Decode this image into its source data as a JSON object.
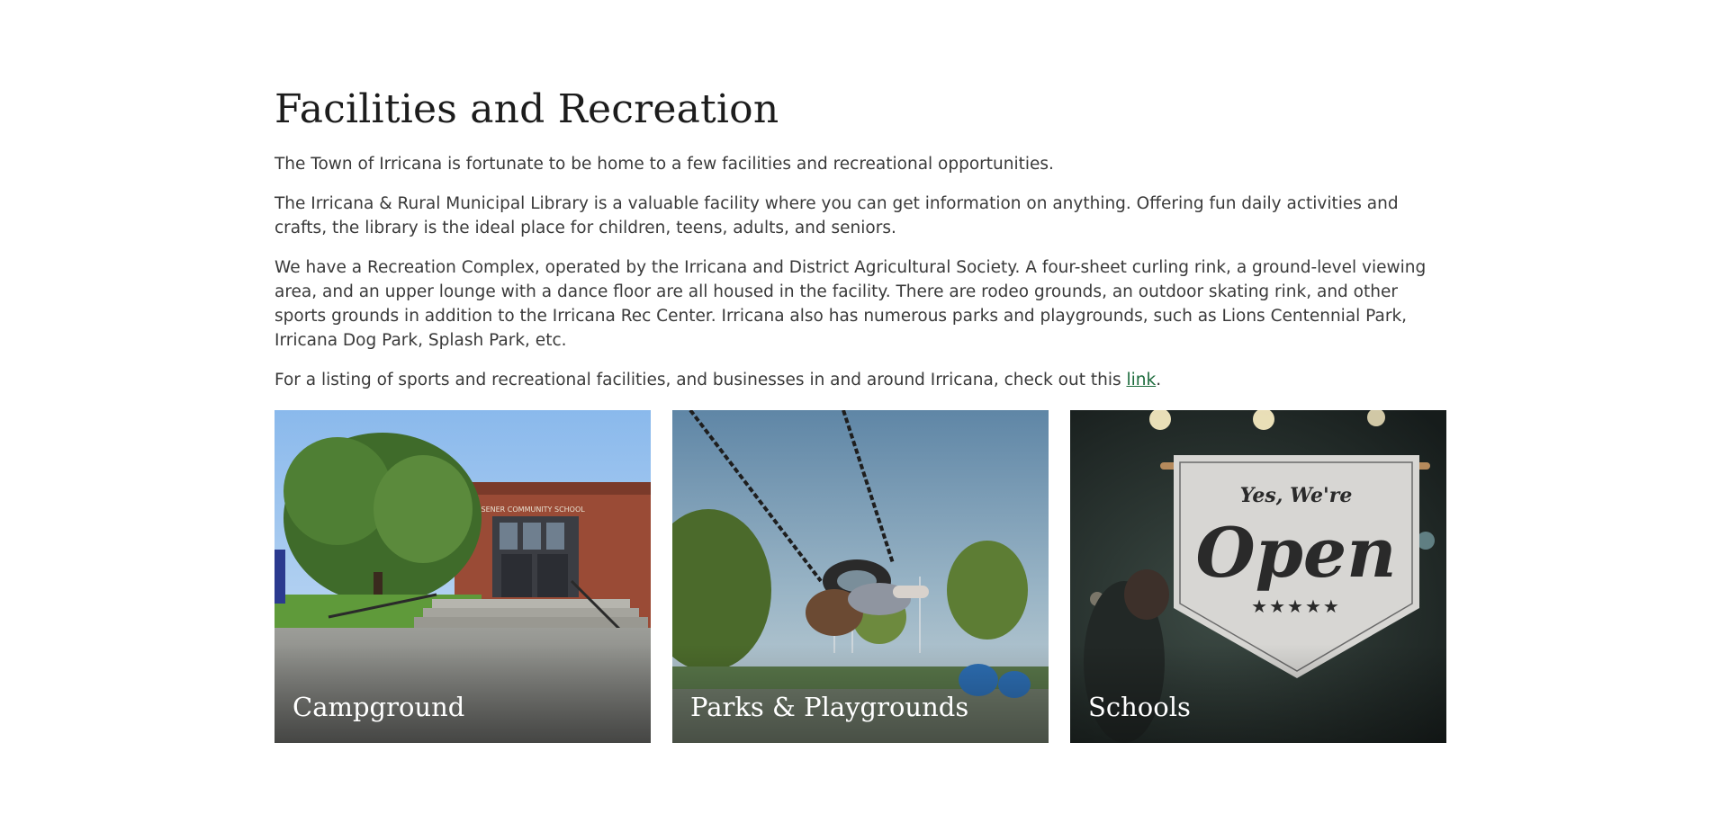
{
  "page": {
    "title": "Facilities and Recreation",
    "paragraphs": {
      "p1": "The Town of Irricana is fortunate to be home to a few facilities and recreational opportunities.",
      "p2": "The Irricana & Rural Municipal Library is a valuable facility where you can get information on anything. Offering fun daily activities and crafts, the library is the ideal place for children, teens, adults, and seniors.",
      "p3": "We have a Recreation Complex, operated by the Irricana and District Agricultural Society. A four-sheet curling rink, a ground-level viewing area, and an upper lounge with a dance floor are all housed in the facility. There are rodeo grounds, an outdoor skating rink, and other sports grounds in addition to the Irricana Rec Center. Irricana also has numerous parks and playgrounds, such as Lions Centennial Park, Irricana Dog Park, Splash Park, etc.",
      "p4_before": "For a listing of sports and recreational facilities, and businesses in and around Irricana, check out this ",
      "p4_link": "link",
      "p4_after": "."
    }
  },
  "cards": [
    {
      "label": "Campground",
      "image_text": "ELSENER COMMUNITY SCHOOL"
    },
    {
      "label": "Parks & Playgrounds"
    },
    {
      "label": "Schools",
      "sign_line1": "Yes, We're",
      "sign_line2": "Open",
      "sign_stars": "★★★★★"
    }
  ],
  "colors": {
    "heading": "#1c1c1c",
    "body_text": "#3a3a3a",
    "link": "#1c6b3c",
    "card_label": "#ffffff"
  }
}
